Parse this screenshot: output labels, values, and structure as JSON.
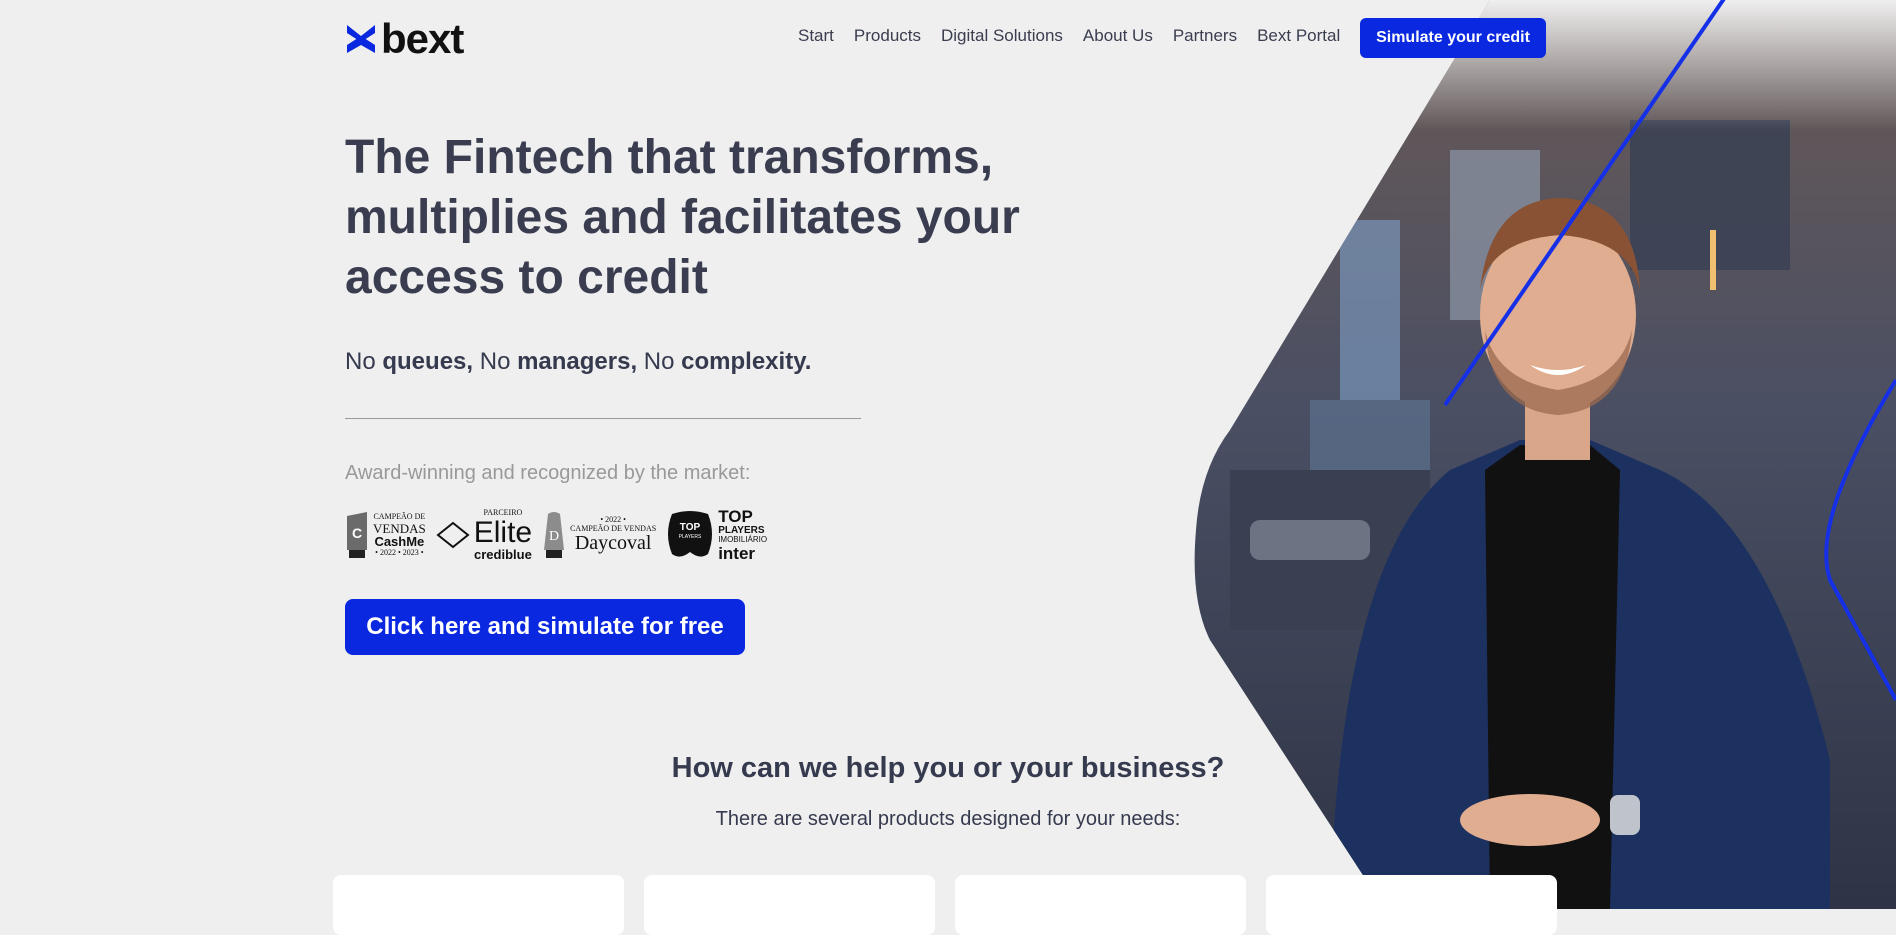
{
  "brand": {
    "name": "bext",
    "color": "#0a28e0"
  },
  "nav": {
    "items": [
      "Start",
      "Products",
      "Digital Solutions",
      "About Us",
      "Partners",
      "Bext Portal"
    ],
    "cta_label": "Simulate your credit"
  },
  "hero": {
    "headline": "The Fintech that transforms, multiplies and facilitates your access to credit",
    "subline": {
      "no1": "No ",
      "word1": "queues,",
      "no2": " No ",
      "word2": "managers,",
      "no3": " No ",
      "word3": "complexity."
    },
    "awards_caption": "Award-winning and recognized by the market:",
    "awards": {
      "cashme": {
        "line1": "CAMPEÃO DE",
        "line2": "VENDAS",
        "line3": "CashMe",
        "line4": "• 2022 • 2023 •"
      },
      "elite": {
        "line1": "PARCEIRO",
        "line2": "Elite",
        "line3": "crediblue"
      },
      "daycoval": {
        "line1": "• 2022 •",
        "line2": "CAMPEÃO DE VENDAS",
        "line3": "Daycoval"
      },
      "inter": {
        "badge": "TOP",
        "badge_small": "PLAYERS",
        "line1": "TOP",
        "line2": "PLAYERS",
        "line3": "IMOBILIÁRIO",
        "line4": "inter"
      }
    },
    "cta_label": "Click here and simulate for free",
    "image": "smiling-man-in-office-photo"
  },
  "products": {
    "title": "How can we help you or your business?",
    "subtitle": "There are several products designed for your needs:"
  }
}
